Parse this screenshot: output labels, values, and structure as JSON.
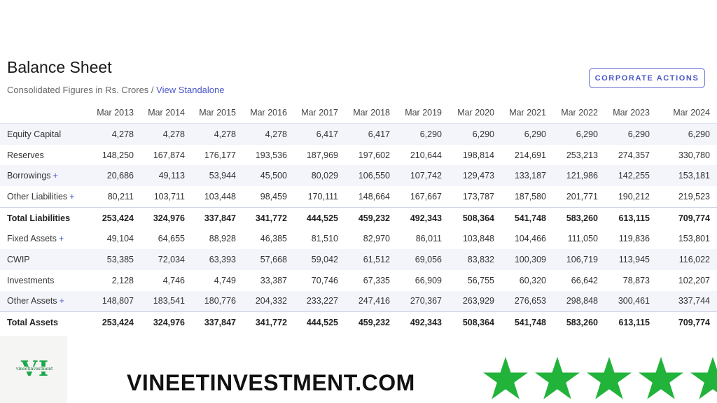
{
  "header": {
    "title": "Balance Sheet",
    "subtitle_prefix": "Consolidated Figures in Rs. Crores / ",
    "subtitle_link": "View Standalone",
    "corporate_actions_label": "CORPORATE ACTIONS"
  },
  "table": {
    "columns": [
      "Mar 2013",
      "Mar 2014",
      "Mar 2015",
      "Mar 2016",
      "Mar 2017",
      "Mar 2018",
      "Mar 2019",
      "Mar 2020",
      "Mar 2021",
      "Mar 2022",
      "Mar 2023",
      "Mar 2024"
    ],
    "expand_symbol": "+",
    "rows": [
      {
        "label": "Equity Capital",
        "expandable": false,
        "total": false,
        "values": [
          "4,278",
          "4,278",
          "4,278",
          "4,278",
          "6,417",
          "6,417",
          "6,290",
          "6,290",
          "6,290",
          "6,290",
          "6,290",
          "6,290"
        ]
      },
      {
        "label": "Reserves",
        "expandable": false,
        "total": false,
        "values": [
          "148,250",
          "167,874",
          "176,177",
          "193,536",
          "187,969",
          "197,602",
          "210,644",
          "198,814",
          "214,691",
          "253,213",
          "274,357",
          "330,780"
        ]
      },
      {
        "label": "Borrowings",
        "expandable": true,
        "total": false,
        "values": [
          "20,686",
          "49,113",
          "53,944",
          "45,500",
          "80,029",
          "106,550",
          "107,742",
          "129,473",
          "133,187",
          "121,986",
          "142,255",
          "153,181"
        ]
      },
      {
        "label": "Other Liabilities",
        "expandable": true,
        "total": false,
        "values": [
          "80,211",
          "103,711",
          "103,448",
          "98,459",
          "170,111",
          "148,664",
          "167,667",
          "173,787",
          "187,580",
          "201,771",
          "190,212",
          "219,523"
        ]
      },
      {
        "label": "Total Liabilities",
        "expandable": false,
        "total": true,
        "values": [
          "253,424",
          "324,976",
          "337,847",
          "341,772",
          "444,525",
          "459,232",
          "492,343",
          "508,364",
          "541,748",
          "583,260",
          "613,115",
          "709,774"
        ]
      },
      {
        "label": "Fixed Assets",
        "expandable": true,
        "total": false,
        "values": [
          "49,104",
          "64,655",
          "88,928",
          "46,385",
          "81,510",
          "82,970",
          "86,011",
          "103,848",
          "104,466",
          "111,050",
          "119,836",
          "153,801"
        ]
      },
      {
        "label": "CWIP",
        "expandable": false,
        "total": false,
        "values": [
          "53,385",
          "72,034",
          "63,393",
          "57,668",
          "59,042",
          "61,512",
          "69,056",
          "83,832",
          "100,309",
          "106,719",
          "113,945",
          "116,022"
        ]
      },
      {
        "label": "Investments",
        "expandable": false,
        "total": false,
        "values": [
          "2,128",
          "4,746",
          "4,749",
          "33,387",
          "70,746",
          "67,335",
          "66,909",
          "56,755",
          "60,320",
          "66,642",
          "78,873",
          "102,207"
        ]
      },
      {
        "label": "Other Assets",
        "expandable": true,
        "total": false,
        "values": [
          "148,807",
          "183,541",
          "180,776",
          "204,332",
          "233,227",
          "247,416",
          "270,367",
          "263,929",
          "276,653",
          "298,848",
          "300,461",
          "337,744"
        ]
      },
      {
        "label": "Total Assets",
        "expandable": false,
        "total": true,
        "values": [
          "253,424",
          "324,976",
          "337,847",
          "341,772",
          "444,525",
          "459,232",
          "492,343",
          "508,364",
          "541,748",
          "583,260",
          "613,115",
          "709,774"
        ]
      }
    ]
  },
  "footer": {
    "logo_text": "vineetinvestment",
    "logo_letter_v": "V",
    "logo_letter_i": "I",
    "brand": "VINEETINVESTMENT.COM",
    "star_count": 5,
    "star_color": "#22b33a"
  },
  "colors": {
    "accent": "#4a56c8",
    "stripe": "#f3f5fb",
    "logo_green": "#1aa84a"
  }
}
